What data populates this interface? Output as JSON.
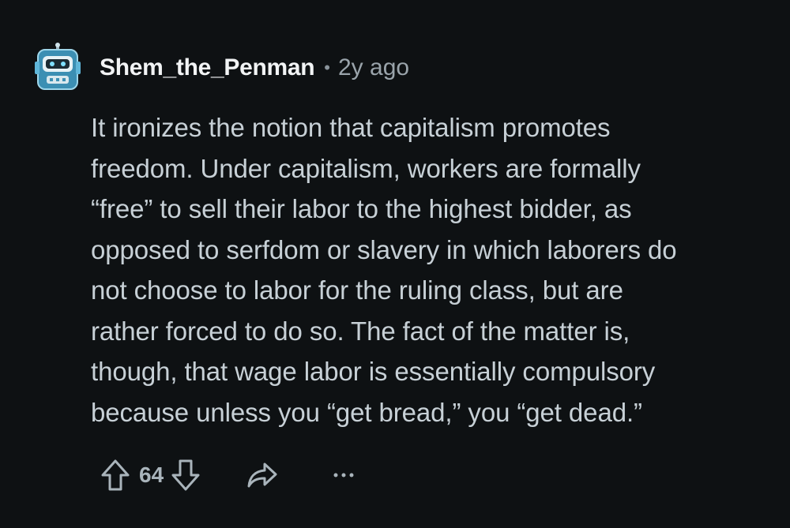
{
  "comment": {
    "author": "Shem_the_Penman",
    "separator": "•",
    "timestamp": "2y ago",
    "avatar": "robot-avatar",
    "body_lines": [
      "It ironizes the notion that capitalism promotes",
      "freedom. Under capitalism, workers are formally",
      "“free” to sell their labor to the highest bidder, as",
      "opposed to serfdom or slavery in which laborers do",
      "not choose to labor for the ruling class, but are",
      "rather forced to do so. The fact of the matter is,",
      "though, that wage labor is essentially compulsory",
      "because unless you “get bread,” you “get dead.”"
    ]
  },
  "actions": {
    "upvote_icon": "arrow-up-icon",
    "vote_count": "64",
    "downvote_icon": "arrow-down-icon",
    "share_icon": "share-icon",
    "more_icon": "more-icon"
  },
  "colors": {
    "background": "#0e1113",
    "text": "#c7d0d6",
    "author": "#f2f4f5",
    "muted": "#9aa4ab",
    "avatar_accent": "#5fb6d9"
  }
}
